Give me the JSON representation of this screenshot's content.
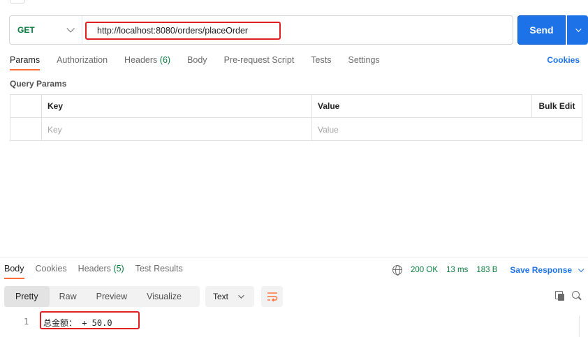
{
  "request": {
    "method": "GET",
    "url": "http://localhost:8080/orders/placeOrder",
    "send_label": "Send"
  },
  "request_tabs": {
    "params": "Params",
    "authorization": "Authorization",
    "headers": "Headers",
    "headers_count": "(6)",
    "body": "Body",
    "pre_request": "Pre-request Script",
    "tests": "Tests",
    "settings": "Settings",
    "cookies": "Cookies"
  },
  "query_params": {
    "section_title": "Query Params",
    "header_key": "Key",
    "header_value": "Value",
    "bulk_edit": "Bulk Edit",
    "key_placeholder": "Key",
    "value_placeholder": "Value"
  },
  "response": {
    "tabs": {
      "body": "Body",
      "cookies": "Cookies",
      "headers": "Headers",
      "headers_count": "(5)",
      "test_results": "Test Results"
    },
    "status": "200 OK",
    "time": "13 ms",
    "size": "183 B",
    "save_label": "Save Response",
    "views": [
      "Pretty",
      "Raw",
      "Preview",
      "Visualize"
    ],
    "active_view": "Pretty",
    "format": "Text",
    "body_lines": [
      {
        "number": "1",
        "text": "总金额： + 50.0"
      }
    ]
  },
  "colors": {
    "accent": "#1d72e8",
    "get_method": "#0a7d3f",
    "active_tab_underline": "#ff6c37",
    "highlight_box": "#e02020"
  },
  "icons": [
    "chevron-down-icon",
    "globe-icon",
    "wrap-lines-icon",
    "copy-icon",
    "search-icon"
  ]
}
